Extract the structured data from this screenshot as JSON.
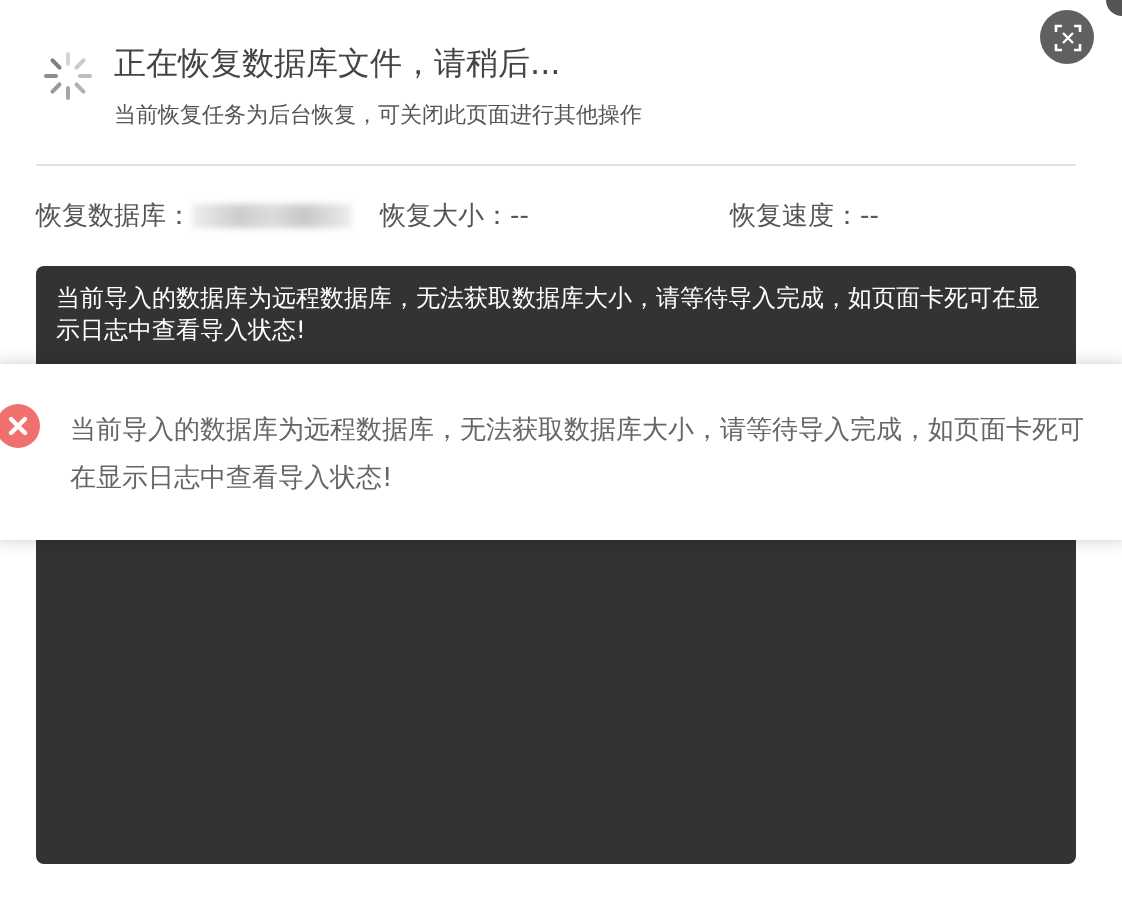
{
  "header": {
    "title": "正在恢复数据库文件，请稍后...",
    "subtitle": "当前恢复任务为后台恢复，可关闭此页面进行其他操作"
  },
  "info": [
    {
      "label": "恢复数据库：",
      "kind": "redacted"
    },
    {
      "label": "恢复大小：",
      "value": "--",
      "kind": "text"
    },
    {
      "label": "恢复速度：",
      "value": "--",
      "kind": "text"
    }
  ],
  "log": {
    "text": "当前导入的数据库为远程数据库，无法获取数据库大小，请等待导入完成，如页面卡死可在显示日志中查看导入状态!"
  },
  "toast": {
    "kind": "error",
    "message": "当前导入的数据库为远程数据库，无法获取数据库大小，请等待导入完成，如页面卡死可在显示日志中查看导入状态!"
  }
}
